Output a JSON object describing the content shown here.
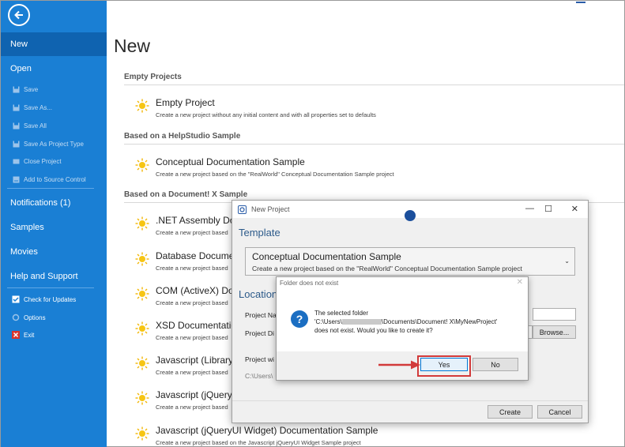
{
  "sidebar": {
    "items": [
      {
        "label": "New",
        "icon": "new-icon"
      },
      {
        "label": "Open",
        "icon": "open-icon"
      },
      {
        "label": "Save",
        "icon": "save-icon"
      },
      {
        "label": "Save As...",
        "icon": "save-as-icon"
      },
      {
        "label": "Save All",
        "icon": "save-all-icon"
      },
      {
        "label": "Save As Project Type",
        "icon": "save-as-project-type-icon"
      },
      {
        "label": "Close Project",
        "icon": "close-project-icon"
      },
      {
        "label": "Add to Source Control",
        "icon": "source-control-icon"
      },
      {
        "label": "Notifications (1)",
        "icon": "notifications-icon"
      },
      {
        "label": "Samples",
        "icon": "samples-icon"
      },
      {
        "label": "Movies",
        "icon": "movies-icon"
      },
      {
        "label": "Help and Support",
        "icon": "help-icon"
      },
      {
        "label": "Check for Updates",
        "icon": "check-updates-icon"
      },
      {
        "label": "Options",
        "icon": "options-icon"
      },
      {
        "label": "Exit",
        "icon": "exit-icon"
      }
    ]
  },
  "main": {
    "title": "New",
    "sections": [
      {
        "heading": "Empty Projects"
      },
      {
        "heading": "Based on a HelpStudio Sample"
      },
      {
        "heading": "Based on a Document! X Sample"
      }
    ],
    "projects": [
      {
        "title": "Empty Project",
        "desc": "Create a new project without any initial content and with all properties set to defaults"
      },
      {
        "title": "Conceptual Documentation Sample",
        "desc": "Create a new project based on the \"RealWorld\" Conceptual Documentation Sample project"
      },
      {
        "title": ".NET Assembly Do",
        "desc": "Create a new project based"
      },
      {
        "title": "Database Docume",
        "desc": "Create a new project based"
      },
      {
        "title": "COM (ActiveX) Do",
        "desc": "Create a new project based"
      },
      {
        "title": "XSD Documentatio",
        "desc": "Create a new project based"
      },
      {
        "title": "Javascript (Library",
        "desc": "Create a new project based"
      },
      {
        "title": "Javascript (jQuery",
        "desc": "Create a new project based"
      },
      {
        "title": "Javascript (jQueryUI Widget) Documentation Sample",
        "desc": "Create a new project based on the Javascript jQueryUI Widget Sample project"
      }
    ]
  },
  "new_project_dialog": {
    "title": "New Project",
    "template_label": "Template",
    "template_selected": "Conceptual Documentation Sample",
    "template_desc": "Create a new project based on the \"RealWorld\" Conceptual Documentation Sample project",
    "location_label": "Location",
    "project_name_label": "Project Na",
    "project_dir_label": "Project Di",
    "project_wi_label": "Project wi",
    "path_preview": "C:\\Users\\",
    "browse_label": "Browse...",
    "create_label": "Create",
    "cancel_label": "Cancel"
  },
  "folder_dialog": {
    "title": "Folder does not exist",
    "line1": "The selected folder",
    "line2": "'C:\\Users\\",
    "line2b": "\\Documents\\Document! X\\MyNewProject'",
    "line3": "does not exist. Would you like to create it?",
    "yes_label": "Yes",
    "no_label": "No"
  },
  "colors": {
    "sidebar": "#1a7fd4",
    "sidebar_active": "#0f63b0",
    "highlight": "#d23a3a"
  }
}
